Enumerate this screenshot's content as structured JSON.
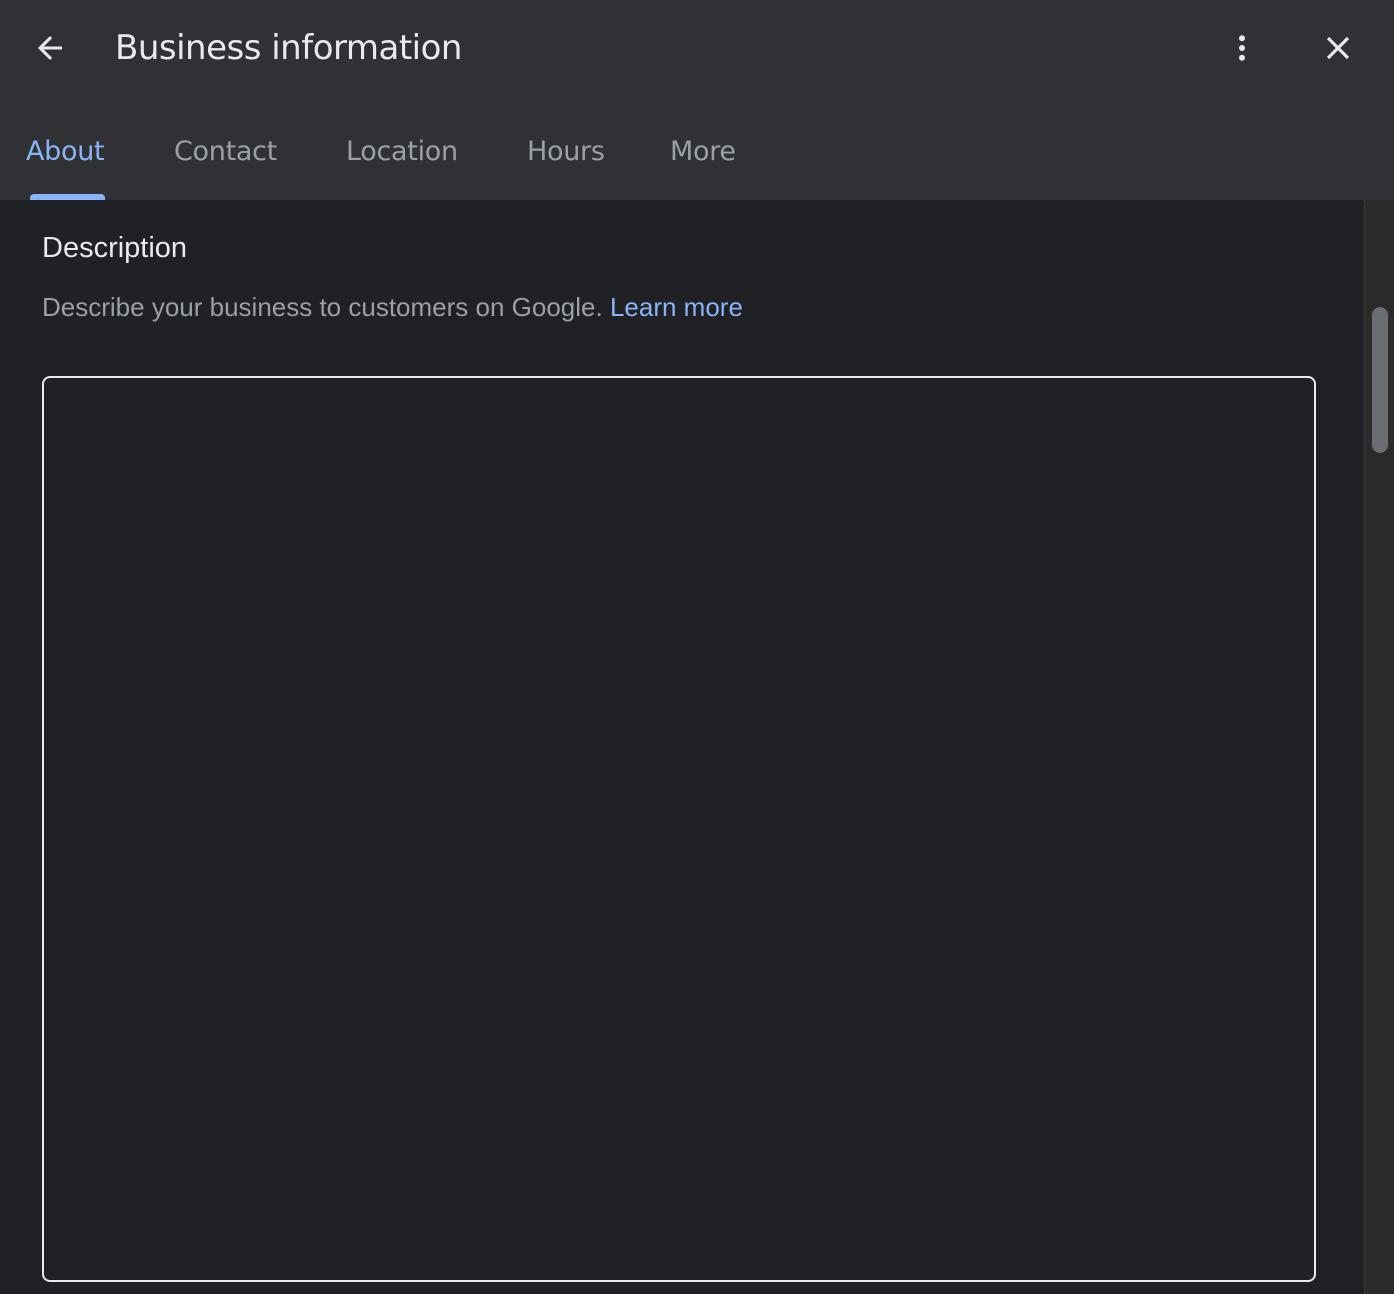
{
  "header": {
    "title": "Business information",
    "back_icon": "arrow-back-icon",
    "more_icon": "more-vert-icon",
    "close_icon": "close-icon"
  },
  "tabs": [
    {
      "label": "About",
      "active": true
    },
    {
      "label": "Contact",
      "active": false
    },
    {
      "label": "Location",
      "active": false
    },
    {
      "label": "Hours",
      "active": false
    },
    {
      "label": "More",
      "active": false
    }
  ],
  "description": {
    "title": "Description",
    "help_text": "Describe your business to customers on Google.",
    "learn_more": "Learn more",
    "value": "",
    "placeholder": ""
  },
  "colors": {
    "header_bg": "#303134",
    "content_bg": "#202124",
    "accent": "#8ab4f8",
    "text_primary": "#e8eaed",
    "text_secondary": "#9aa0a6"
  }
}
